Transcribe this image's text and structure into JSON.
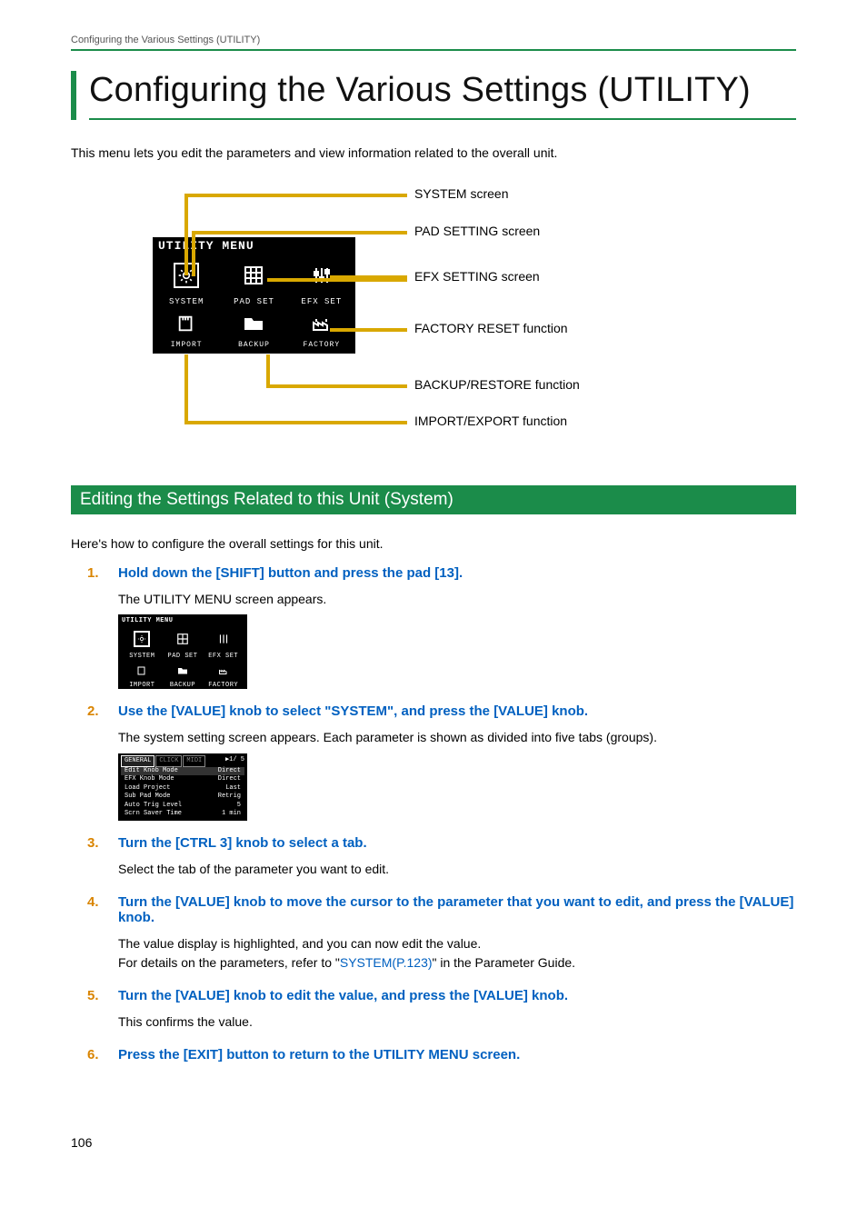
{
  "header": {
    "breadcrumb": "Configuring the Various Settings (UTILITY)"
  },
  "title": "Configuring the Various Settings (UTILITY)",
  "intro": "This menu lets you edit the parameters and view information related to the overall unit.",
  "diagram": {
    "lcd_title": "UTILITY MENU",
    "cells": {
      "c0": "SYSTEM",
      "c1": "PAD SET",
      "c2": "EFX SET",
      "c3": "IMPORT",
      "c4": "BACKUP",
      "c5": "FACTORY"
    },
    "callouts": {
      "system": "SYSTEM screen",
      "padset": "PAD SETTING screen",
      "efxset": "EFX SETTING screen",
      "factory": "FACTORY RESET function",
      "backup": "BACKUP/RESTORE function",
      "import": "IMPORT/EXPORT function"
    }
  },
  "section_bar": "Editing the Settings Related to this Unit (System)",
  "section_intro": "Here's how to configure the overall settings for this unit.",
  "steps": [
    {
      "num": "1.",
      "title": "Hold down the [SHIFT] button and press the pad [13].",
      "body": "The UTILITY MENU screen appears.",
      "shot": "menu"
    },
    {
      "num": "2.",
      "title": "Use the [VALUE] knob to select \"SYSTEM\", and press the [VALUE] knob.",
      "body": "The system setting screen appears. Each parameter is shown as divided into five tabs (groups).",
      "shot": "system"
    },
    {
      "num": "3.",
      "title": "Turn the [CTRL 3] knob to select a tab.",
      "body": "Select the tab of the parameter you want to edit."
    },
    {
      "num": "4.",
      "title": "Turn the [VALUE] knob to move the cursor to the parameter that you want to edit, and press the [VALUE] knob.",
      "body_plain_1": "The value display is highlighted, and you can now edit the value.",
      "body_plain_2a": "For details on the parameters, refer to \"",
      "xref": "SYSTEM(P.123)",
      "body_plain_2b": "\" in the Parameter Guide."
    },
    {
      "num": "5.",
      "title": "Turn the [VALUE] knob to edit the value, and press the [VALUE] knob.",
      "body": "This confirms the value."
    },
    {
      "num": "6.",
      "title": "Press the [EXIT] button to return to the UTILITY MENU screen."
    }
  ],
  "shot_menu": {
    "title": "UTILITY MENU",
    "labels": [
      "SYSTEM",
      "PAD SET",
      "EFX SET",
      "IMPORT",
      "BACKUP",
      "FACTORY"
    ]
  },
  "shot_system": {
    "tabs": [
      "GENERAL",
      "CLICK",
      "MIDI"
    ],
    "page": "▶1/ 5",
    "rows": [
      {
        "k": "Edit Knob Mode",
        "v": "Direct"
      },
      {
        "k": "EFX Knob Mode",
        "v": "Direct"
      },
      {
        "k": "Load Project",
        "v": "Last"
      },
      {
        "k": "Sub Pad Mode",
        "v": "Retrig"
      },
      {
        "k": "Auto Trig Level",
        "v": "5"
      },
      {
        "k": "Scrn Saver Time",
        "v": "1 min"
      }
    ]
  },
  "page_number": "106"
}
